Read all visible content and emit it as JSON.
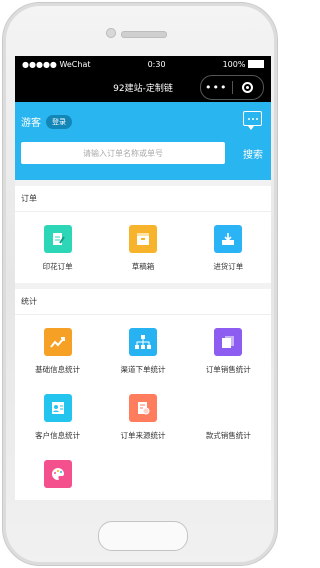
{
  "status": {
    "signal": "●●●●● WeChat",
    "time": "0:30",
    "battery": "100%"
  },
  "navbar": {
    "title": "92建站-定制链",
    "more_icon": "•••"
  },
  "header": {
    "guest_label": "游客",
    "login_label": "登录",
    "search_placeholder": "请输入订单名称或单号",
    "search_label": "搜索"
  },
  "orders": {
    "title": "订单",
    "items": [
      {
        "label": "印花订单",
        "icon": "print-order-icon",
        "color": "#2ed6b8"
      },
      {
        "label": "草稿箱",
        "icon": "draft-box-icon",
        "color": "#f8b32c"
      },
      {
        "label": "进货订单",
        "icon": "purchase-order-icon",
        "color": "#2ab4f5"
      }
    ]
  },
  "stats": {
    "title": "统计",
    "items": [
      {
        "label": "基础信息统计",
        "icon": "basic-info-stats-icon",
        "color": "#f6a126"
      },
      {
        "label": "渠道下单统计",
        "icon": "channel-order-stats-icon",
        "color": "#27b3f2"
      },
      {
        "label": "订单销售统计",
        "icon": "order-sales-stats-icon",
        "color": "#8d5cf0"
      },
      {
        "label": "客户信息统计",
        "icon": "customer-info-stats-icon",
        "color": "#23c4ee"
      },
      {
        "label": "订单来源统计",
        "icon": "order-source-stats-icon",
        "color": "#ff7d5c"
      },
      {
        "label": "款式销售统计",
        "icon": "style-sales-stats-icon",
        "color": "#ffffff"
      },
      {
        "label": "",
        "icon": "palette-icon",
        "color": "#f4508e"
      }
    ]
  }
}
